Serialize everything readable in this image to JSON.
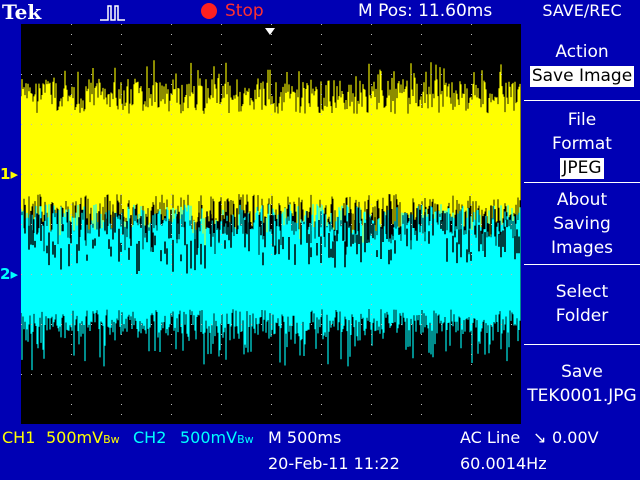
{
  "header": {
    "brand": "Tek",
    "status": "Stop",
    "position": "M Pos: 11.60ms",
    "menu_title": "SAVE/REC"
  },
  "menu": {
    "action_label": "Action",
    "action_value": "Save Image",
    "format_label_1": "File",
    "format_label_2": "Format",
    "format_value": "JPEG",
    "about_1": "About",
    "about_2": "Saving",
    "about_3": "Images",
    "select_1": "Select",
    "select_2": "Folder",
    "save_1": "Save",
    "save_2": "TEK0001.JPG"
  },
  "markers": {
    "ch1": "1",
    "ch2": "2"
  },
  "footer": {
    "ch1_label": "CH1",
    "ch1_scale": "500mV",
    "ch1_bw": "Bw",
    "ch2_label": "CH2",
    "ch2_scale": "500mV",
    "ch2_bw": "Bw",
    "timebase": "M 500ms",
    "trigger_source": "AC Line",
    "trigger_level": "0.00V",
    "date": "20-Feb-11 11:22",
    "frequency": "60.0014Hz"
  },
  "colors": {
    "background": "#0000b4",
    "ch1": "#ffff00",
    "ch2": "#00ffff",
    "stop": "#ff3030"
  }
}
